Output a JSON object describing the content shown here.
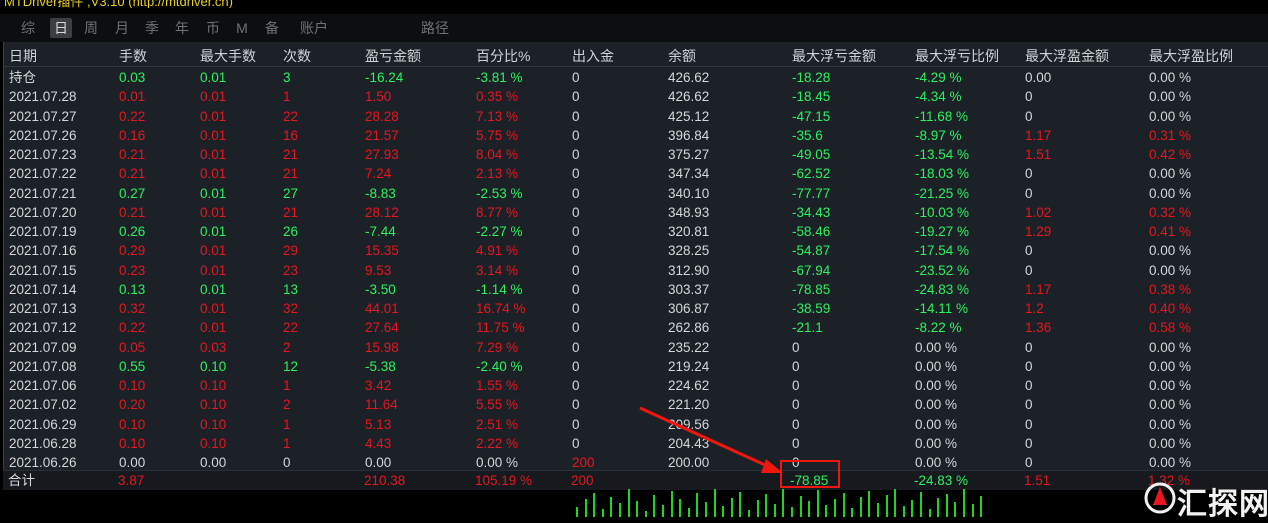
{
  "app_title": "MTDriver插件 ,V3.10 (http://mtdriver.cn)",
  "tabs": [
    "综",
    "日",
    "周",
    "月",
    "季",
    "年",
    "币",
    "M",
    "备",
    "账户",
    "路径"
  ],
  "active_tab": "日",
  "columns": [
    "日期",
    "手数",
    "最大手数",
    "次数",
    "盈亏金额",
    "百分比%",
    "出入金",
    "余额",
    "最大浮亏金额",
    "最大浮亏比例",
    "最大浮盈金额",
    "最大浮盈比例"
  ],
  "rows": [
    {
      "date": "持仓",
      "lots": "0.03",
      "max_lots": "0.01",
      "count": "3",
      "pnl": "-16.24",
      "pct": "-3.81 %",
      "io": "0",
      "balance": "426.62",
      "max_float_loss": "-18.28",
      "max_float_loss_pct": "-4.29 %",
      "max_float_profit": "0.00",
      "max_float_profit_pct": "0.00 %"
    },
    {
      "date": "2021.07.28",
      "lots": "0.01",
      "max_lots": "0.01",
      "count": "1",
      "pnl": "1.50",
      "pct": "0.35 %",
      "io": "0",
      "balance": "426.62",
      "max_float_loss": "-18.45",
      "max_float_loss_pct": "-4.34 %",
      "max_float_profit": "0",
      "max_float_profit_pct": "0.00 %"
    },
    {
      "date": "2021.07.27",
      "lots": "0.22",
      "max_lots": "0.01",
      "count": "22",
      "pnl": "28.28",
      "pct": "7.13 %",
      "io": "0",
      "balance": "425.12",
      "max_float_loss": "-47.15",
      "max_float_loss_pct": "-11.68 %",
      "max_float_profit": "0",
      "max_float_profit_pct": "0.00 %"
    },
    {
      "date": "2021.07.26",
      "lots": "0.16",
      "max_lots": "0.01",
      "count": "16",
      "pnl": "21.57",
      "pct": "5.75 %",
      "io": "0",
      "balance": "396.84",
      "max_float_loss": "-35.6",
      "max_float_loss_pct": "-8.97 %",
      "max_float_profit": "1.17",
      "max_float_profit_pct": "0.31 %"
    },
    {
      "date": "2021.07.23",
      "lots": "0.21",
      "max_lots": "0.01",
      "count": "21",
      "pnl": "27.93",
      "pct": "8.04 %",
      "io": "0",
      "balance": "375.27",
      "max_float_loss": "-49.05",
      "max_float_loss_pct": "-13.54 %",
      "max_float_profit": "1.51",
      "max_float_profit_pct": "0.42 %"
    },
    {
      "date": "2021.07.22",
      "lots": "0.21",
      "max_lots": "0.01",
      "count": "21",
      "pnl": "7.24",
      "pct": "2.13 %",
      "io": "0",
      "balance": "347.34",
      "max_float_loss": "-62.52",
      "max_float_loss_pct": "-18.03 %",
      "max_float_profit": "0",
      "max_float_profit_pct": "0.00 %"
    },
    {
      "date": "2021.07.21",
      "lots": "0.27",
      "max_lots": "0.01",
      "count": "27",
      "pnl": "-8.83",
      "pct": "-2.53 %",
      "io": "0",
      "balance": "340.10",
      "max_float_loss": "-77.77",
      "max_float_loss_pct": "-21.25 %",
      "max_float_profit": "0",
      "max_float_profit_pct": "0.00 %"
    },
    {
      "date": "2021.07.20",
      "lots": "0.21",
      "max_lots": "0.01",
      "count": "21",
      "pnl": "28.12",
      "pct": "8.77 %",
      "io": "0",
      "balance": "348.93",
      "max_float_loss": "-34.43",
      "max_float_loss_pct": "-10.03 %",
      "max_float_profit": "1.02",
      "max_float_profit_pct": "0.32 %"
    },
    {
      "date": "2021.07.19",
      "lots": "0.26",
      "max_lots": "0.01",
      "count": "26",
      "pnl": "-7.44",
      "pct": "-2.27 %",
      "io": "0",
      "balance": "320.81",
      "max_float_loss": "-58.46",
      "max_float_loss_pct": "-19.27 %",
      "max_float_profit": "1.29",
      "max_float_profit_pct": "0.41 %"
    },
    {
      "date": "2021.07.16",
      "lots": "0.29",
      "max_lots": "0.01",
      "count": "29",
      "pnl": "15.35",
      "pct": "4.91 %",
      "io": "0",
      "balance": "328.25",
      "max_float_loss": "-54.87",
      "max_float_loss_pct": "-17.54 %",
      "max_float_profit": "0",
      "max_float_profit_pct": "0.00 %"
    },
    {
      "date": "2021.07.15",
      "lots": "0.23",
      "max_lots": "0.01",
      "count": "23",
      "pnl": "9.53",
      "pct": "3.14 %",
      "io": "0",
      "balance": "312.90",
      "max_float_loss": "-67.94",
      "max_float_loss_pct": "-23.52 %",
      "max_float_profit": "0",
      "max_float_profit_pct": "0.00 %"
    },
    {
      "date": "2021.07.14",
      "lots": "0.13",
      "max_lots": "0.01",
      "count": "13",
      "pnl": "-3.50",
      "pct": "-1.14 %",
      "io": "0",
      "balance": "303.37",
      "max_float_loss": "-78.85",
      "max_float_loss_pct": "-24.83 %",
      "max_float_profit": "1.17",
      "max_float_profit_pct": "0.38 %"
    },
    {
      "date": "2021.07.13",
      "lots": "0.32",
      "max_lots": "0.01",
      "count": "32",
      "pnl": "44.01",
      "pct": "16.74 %",
      "io": "0",
      "balance": "306.87",
      "max_float_loss": "-38.59",
      "max_float_loss_pct": "-14.11 %",
      "max_float_profit": "1.2",
      "max_float_profit_pct": "0.40 %"
    },
    {
      "date": "2021.07.12",
      "lots": "0.22",
      "max_lots": "0.01",
      "count": "22",
      "pnl": "27.64",
      "pct": "11.75 %",
      "io": "0",
      "balance": "262.86",
      "max_float_loss": "-21.1",
      "max_float_loss_pct": "-8.22 %",
      "max_float_profit": "1.36",
      "max_float_profit_pct": "0.58 %"
    },
    {
      "date": "2021.07.09",
      "lots": "0.05",
      "max_lots": "0.03",
      "count": "2",
      "pnl": "15.98",
      "pct": "7.29 %",
      "io": "0",
      "balance": "235.22",
      "max_float_loss": "0",
      "max_float_loss_pct": "0.00 %",
      "max_float_profit": "0",
      "max_float_profit_pct": "0.00 %"
    },
    {
      "date": "2021.07.08",
      "lots": "0.55",
      "max_lots": "0.10",
      "count": "12",
      "pnl": "-5.38",
      "pct": "-2.40 %",
      "io": "0",
      "balance": "219.24",
      "max_float_loss": "0",
      "max_float_loss_pct": "0.00 %",
      "max_float_profit": "0",
      "max_float_profit_pct": "0.00 %"
    },
    {
      "date": "2021.07.06",
      "lots": "0.10",
      "max_lots": "0.10",
      "count": "1",
      "pnl": "3.42",
      "pct": "1.55 %",
      "io": "0",
      "balance": "224.62",
      "max_float_loss": "0",
      "max_float_loss_pct": "0.00 %",
      "max_float_profit": "0",
      "max_float_profit_pct": "0.00 %"
    },
    {
      "date": "2021.07.02",
      "lots": "0.20",
      "max_lots": "0.10",
      "count": "2",
      "pnl": "11.64",
      "pct": "5.55 %",
      "io": "0",
      "balance": "221.20",
      "max_float_loss": "0",
      "max_float_loss_pct": "0.00 %",
      "max_float_profit": "0",
      "max_float_profit_pct": "0.00 %"
    },
    {
      "date": "2021.06.29",
      "lots": "0.10",
      "max_lots": "0.10",
      "count": "1",
      "pnl": "5.13",
      "pct": "2.51 %",
      "io": "0",
      "balance": "209.56",
      "max_float_loss": "0",
      "max_float_loss_pct": "0.00 %",
      "max_float_profit": "0",
      "max_float_profit_pct": "0.00 %"
    },
    {
      "date": "2021.06.28",
      "lots": "0.10",
      "max_lots": "0.10",
      "count": "1",
      "pnl": "4.43",
      "pct": "2.22 %",
      "io": "0",
      "balance": "204.43",
      "max_float_loss": "0",
      "max_float_loss_pct": "0.00 %",
      "max_float_profit": "0",
      "max_float_profit_pct": "0.00 %"
    },
    {
      "date": "2021.06.26",
      "lots": "0.00",
      "max_lots": "0.00",
      "count": "0",
      "pnl": "0.00",
      "pct": "0.00 %",
      "io": "200",
      "balance": "200.00",
      "max_float_loss": "0",
      "max_float_loss_pct": "0.00 %",
      "max_float_profit": "0",
      "max_float_profit_pct": "0.00 %"
    }
  ],
  "total": {
    "label": "合计",
    "lots": "3.87",
    "pnl": "210.38",
    "pct": "105.19 %",
    "io": "200",
    "max_float_loss": "-78.85",
    "max_float_loss_pct": "-24.83 %",
    "max_float_profit": "1.51",
    "max_float_profit_pct": "1.32 %"
  },
  "watermark": "汇探网",
  "colors": {
    "loss": "#2cf15e",
    "profit": "#e8161f",
    "neutral": "#d4d6d8",
    "highlight": "#f0160e",
    "panel": "#1b2127"
  }
}
